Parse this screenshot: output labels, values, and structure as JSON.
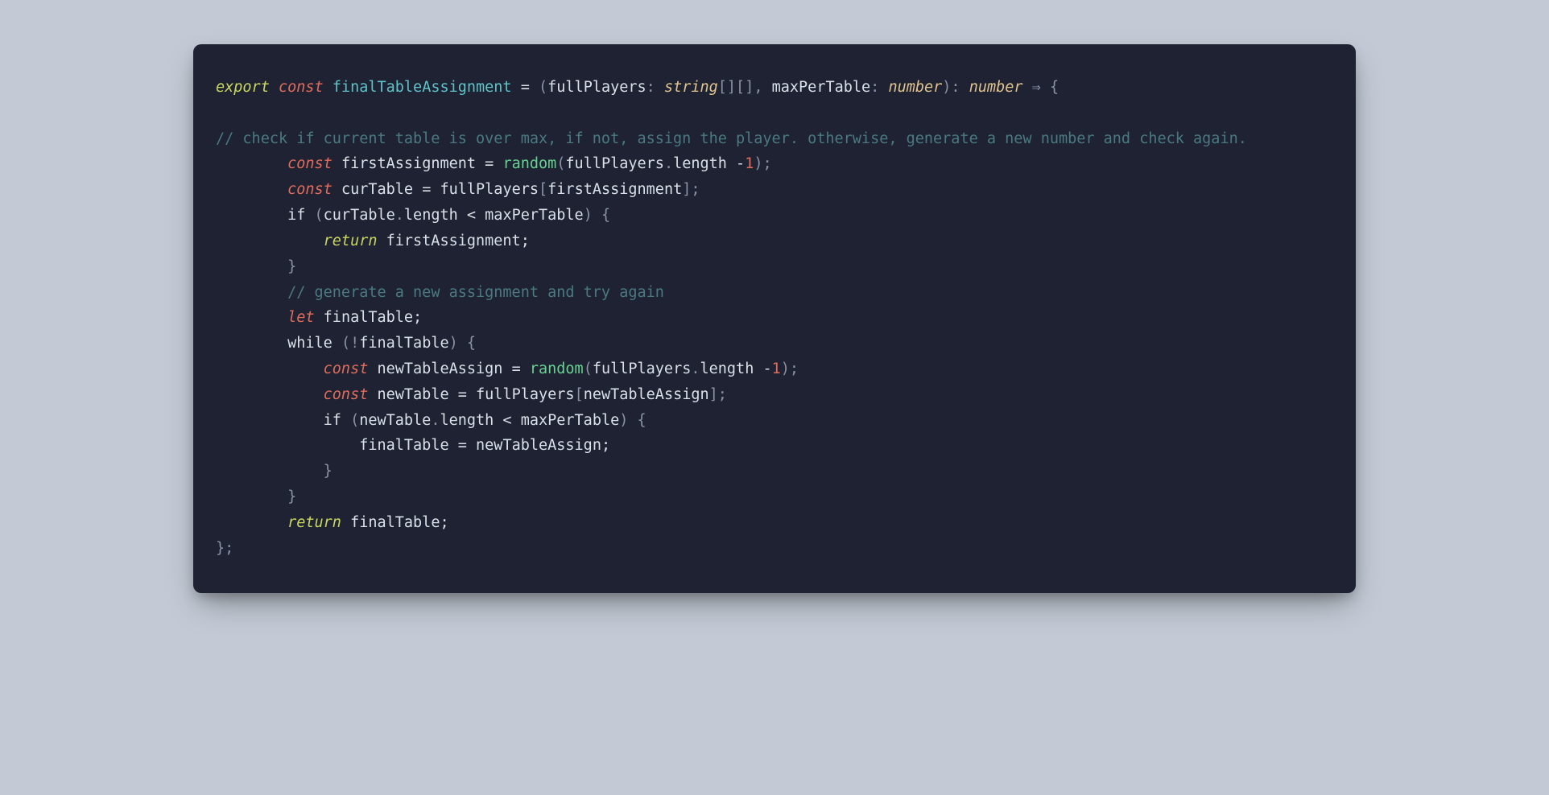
{
  "code": {
    "line1": {
      "export": "export",
      "const": "const",
      "funcName": "finalTableAssignment",
      "eq": " = ",
      "open": "(",
      "param1": "fullPlayers",
      "colon1": ": ",
      "type1": "string",
      "arr1": "[][]",
      "comma": ", ",
      "param2": "maxPerTable",
      "colon2": ": ",
      "type2": "number",
      "close": ")",
      "retcolon": ": ",
      "rettype": "number",
      "arrow": " ⇒ ",
      "brace": "{"
    },
    "comment1": "// check if current table is over max, if not, assign the player. otherwise, generate a new number and check again.",
    "line3": {
      "const": "const",
      "name": " firstAssignment ",
      "eq": "= ",
      "func": "random",
      "open": "(",
      "obj": "fullPlayers",
      "dot": ".",
      "prop": "length",
      "minus": " -",
      "num": "1",
      "close": ");"
    },
    "line4": {
      "const": "const",
      "name": " curTable ",
      "eq": "= ",
      "obj": "fullPlayers",
      "open": "[",
      "idx": "firstAssignment",
      "close": "];"
    },
    "line5": {
      "if": "if",
      "open": " (",
      "obj": "curTable",
      "dot": ".",
      "prop": "length",
      "lt": " < ",
      "var": "maxPerTable",
      "close": ") {"
    },
    "line6": {
      "return": "return",
      "val": " firstAssignment;"
    },
    "line7": {
      "brace": "}"
    },
    "comment2": "// generate a new assignment and try again",
    "line9": {
      "let": "let",
      "val": " finalTable;"
    },
    "line10": {
      "while": "while",
      "open": " (!",
      "var": "finalTable",
      "close": ") {"
    },
    "line11": {
      "const": "const",
      "name": " newTableAssign ",
      "eq": "= ",
      "func": "random",
      "open": "(",
      "obj": "fullPlayers",
      "dot": ".",
      "prop": "length",
      "minus": " -",
      "num": "1",
      "close": ");"
    },
    "line12": {
      "const": "const",
      "name": " newTable ",
      "eq": "= ",
      "obj": "fullPlayers",
      "open": "[",
      "idx": "newTableAssign",
      "close": "];"
    },
    "line13": {
      "if": "if",
      "open": " (",
      "obj": "newTable",
      "dot": ".",
      "prop": "length",
      "lt": " < ",
      "var": "maxPerTable",
      "close": ") {"
    },
    "line14": {
      "lhs": "finalTable ",
      "eq": "= ",
      "rhs": "newTableAssign;"
    },
    "line15": {
      "brace": "}"
    },
    "line16": {
      "brace": "}"
    },
    "line17": {
      "return": "return",
      "val": " finalTable;"
    },
    "line18": {
      "brace": "};"
    }
  }
}
